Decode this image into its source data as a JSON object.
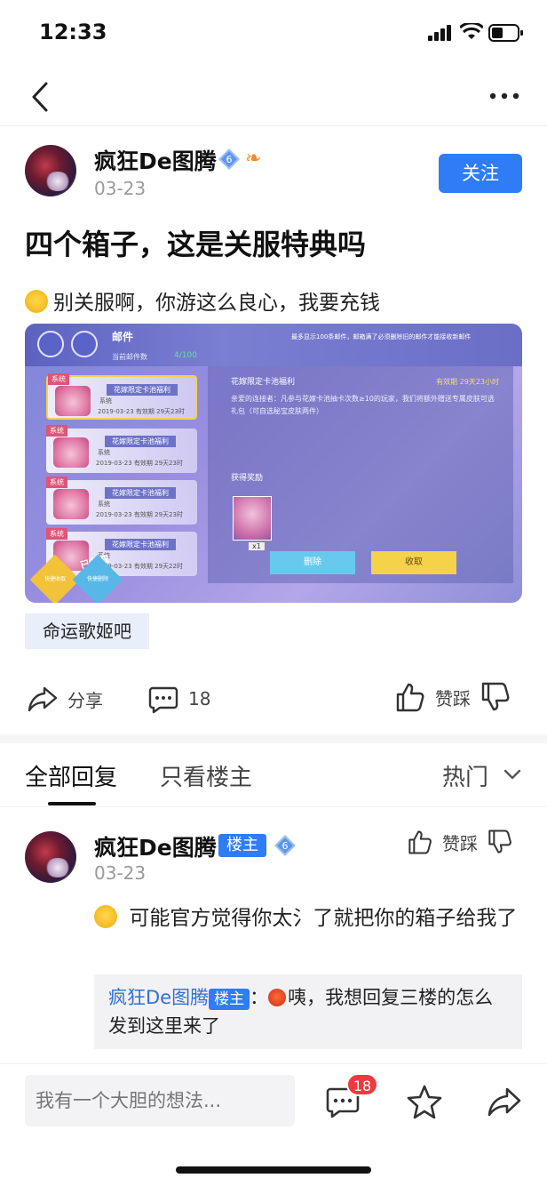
{
  "status_bar": {
    "time": "12:33"
  },
  "post": {
    "author": "疯狂De图腾",
    "level": "6",
    "date": "03-23",
    "follow_label": "关注",
    "title": "四个箱子，这是关服特典吗",
    "body": "别关服啊，你游这么良心，我要充钱",
    "forum_tag": "命运歌姬吧",
    "share_label": "分享",
    "comment_count": "18",
    "vote_label": "赞踩"
  },
  "game_screenshot": {
    "mail_title": "邮件",
    "mail_count_label": "当前邮件数",
    "mail_count": "4/100",
    "warning": "最多显示100条邮件，邮箱满了必须删除旧的邮件才能接收新邮件",
    "cards": [
      {
        "tag": "系统",
        "title": "花嫁限定卡池福利",
        "sub": "系统",
        "date": "2019-03-23  有效期 29天23时"
      },
      {
        "tag": "系统",
        "title": "花嫁限定卡池福利",
        "sub": "系统",
        "date": "2019-03-23  有效期 29天23时"
      },
      {
        "tag": "系统",
        "title": "花嫁限定卡池福利",
        "sub": "系统",
        "date": "2019-03-23  有效期 29天23时"
      },
      {
        "tag": "系统",
        "title": "花嫁限定卡池福利",
        "sub": "系统",
        "date": "2019-03-23  有效期 29天22时"
      }
    ],
    "detail_title": "花嫁限定卡池福利",
    "detail_expire": "有效期 29天23小时",
    "detail_text": "亲爱的连接者：凡参与花嫁卡池抽卡次数≥10的玩家，我们将额外赠送专属皮肤可选礼包（可自选秘宝皮肤两件）",
    "reward_label": "获得奖励",
    "reward_qty": "x1",
    "delete_label": "删除",
    "receive_label": "收取",
    "stamp_label": "已领取",
    "quick_receive": "快捷收取",
    "quick_delete": "快捷删除"
  },
  "tabs": {
    "all": "全部回复",
    "owner_only": "只看楼主",
    "sort": "热门"
  },
  "reply": {
    "author": "疯狂De图腾",
    "owner_badge": "楼主",
    "level": "6",
    "date": "03-23",
    "vote_label": "赞踩",
    "text": "可能官方觉得你太氵了就把你的箱子给我了",
    "quote": {
      "name": "疯狂De图腾",
      "owner_badge": "楼主",
      "colon": "：",
      "text": "咦，我想回复三楼的怎么发到这里来了"
    }
  },
  "bottom_bar": {
    "input_placeholder": "我有一个大胆的想法...",
    "comment_badge": "18"
  },
  "colors": {
    "accent": "#2e7cf6",
    "badge_red": "#f0393f"
  }
}
